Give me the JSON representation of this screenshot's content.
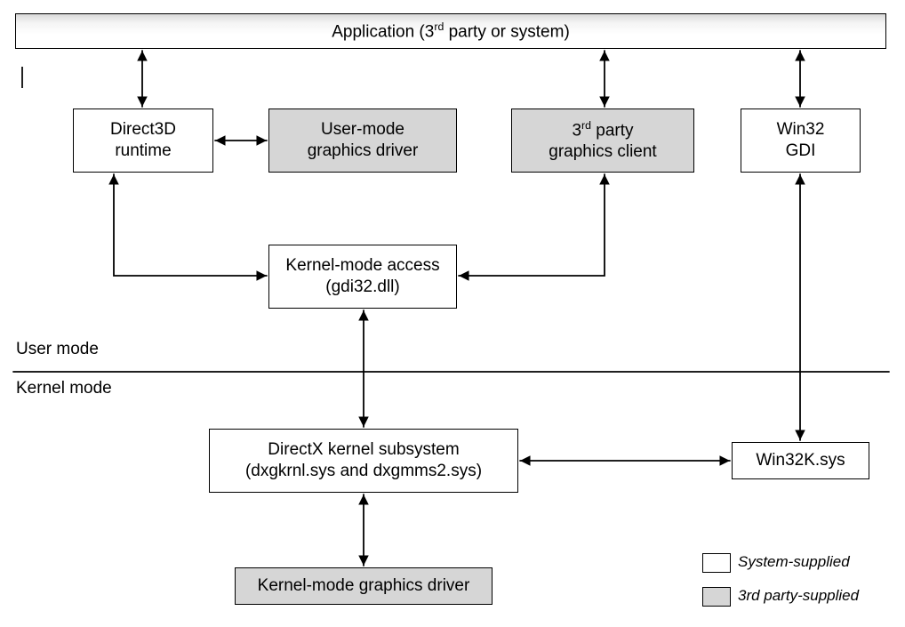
{
  "title_prefix": "Application (3",
  "title_ord": "rd",
  "title_suffix": " party or system)",
  "d3d_l1": "Direct3D",
  "d3d_l2": "runtime",
  "umgd_l1": "User-mode",
  "umgd_l2": "graphics driver",
  "client_prefix": "3",
  "client_ord": "rd",
  "client_mid": " party",
  "client_l2": "graphics client",
  "gdi_l1": "Win32",
  "gdi_l2": "GDI",
  "kma_l1": "Kernel-mode access",
  "kma_l2": "(gdi32.dll)",
  "user_mode_label": "User mode",
  "kernel_mode_label": "Kernel mode",
  "dxk_l1": "DirectX kernel subsystem",
  "dxk_l2": "(dxgkrnl.sys and dxgmms2.sys)",
  "win32k": "Win32K.sys",
  "kmgd": "Kernel-mode graphics driver",
  "legend_system": "System-supplied",
  "legend_thirdparty": "3rd party-supplied"
}
